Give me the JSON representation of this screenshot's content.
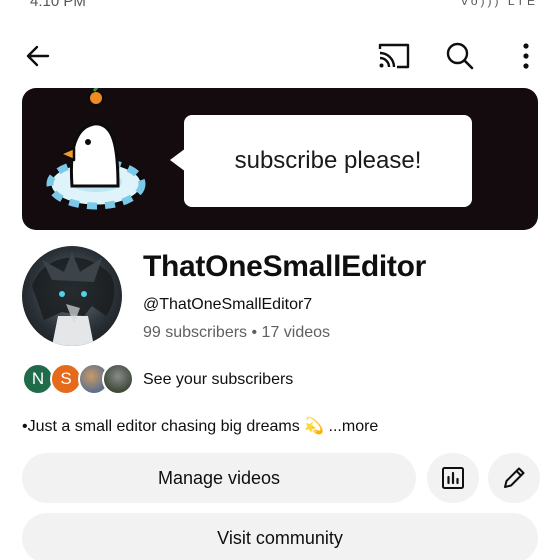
{
  "status_bar": {
    "time": "4:10 PM",
    "right": "Vo))) LTE"
  },
  "app_bar": {
    "back_icon": "arrow-left-icon",
    "cast_icon": "cast-icon",
    "search_icon": "search-icon",
    "more_icon": "more-vertical-icon"
  },
  "banner": {
    "text": "subscribe please!"
  },
  "channel": {
    "name": "ThatOneSmallEditor",
    "handle": "@ThatOneSmallEditor7",
    "stats": "99 subscribers • 17 videos"
  },
  "subscribers": {
    "avatars": [
      "N",
      "S"
    ],
    "label": "See your subscribers"
  },
  "description": {
    "text": "•Just a small editor chasing big dreams 💫",
    "more": " ...more"
  },
  "actions": {
    "manage_label": "Manage videos",
    "analytics_icon": "analytics-icon",
    "edit_icon": "pencil-icon",
    "community_label": "Visit community"
  }
}
